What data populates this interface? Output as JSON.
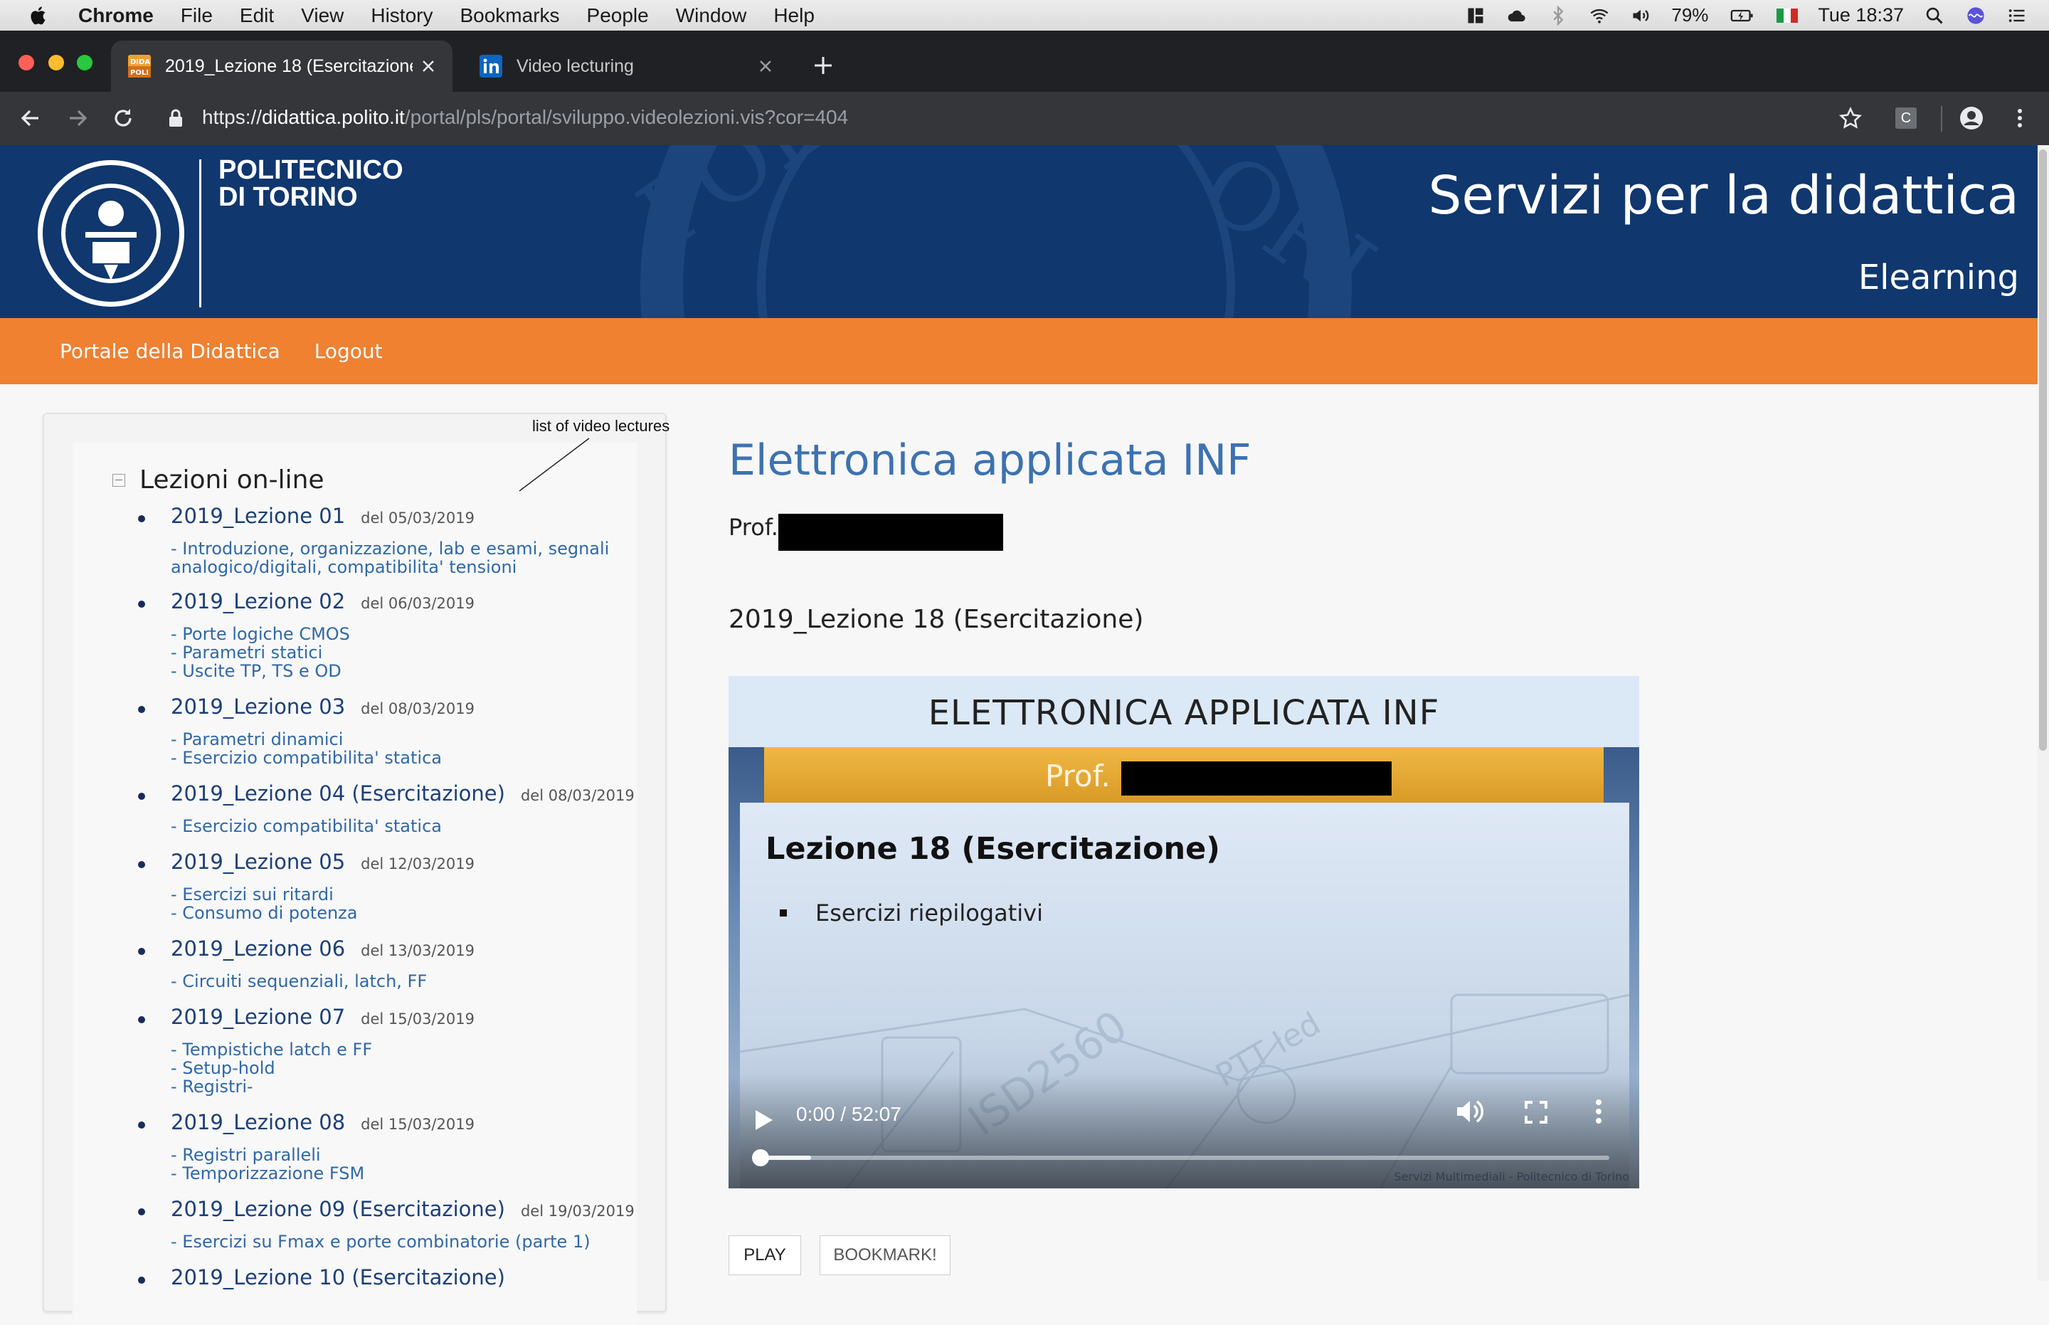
{
  "menubar": {
    "app": "Chrome",
    "items": [
      "File",
      "Edit",
      "View",
      "History",
      "Bookmarks",
      "People",
      "Window",
      "Help"
    ],
    "battery": "79%",
    "clock": "Tue 18:37"
  },
  "browser": {
    "tabs": [
      {
        "title": "2019_Lezione 18 (Esercitazione)",
        "favicon": "didattica-polito-icon",
        "active": true
      },
      {
        "title": "Video lecturing",
        "favicon": "linkedin-icon",
        "active": false
      }
    ],
    "url_protocol": "https://",
    "url_host": "didattica.polito.it",
    "url_path": "/portal/pls/portal/sviluppo.videolezioni.vis?cor=404",
    "extension_label": "C"
  },
  "header": {
    "logo_line1": "POLITECNICO",
    "logo_line2": "DI TORINO",
    "service_title": "Servizi per la didattica",
    "service_subtitle": "Elearning",
    "color": "#10376e"
  },
  "nav": {
    "links": [
      "Portale della Didattica",
      "Logout"
    ],
    "color": "#ef8131"
  },
  "sidebar": {
    "annotation": "list of video lectures",
    "tree_title": "Lezioni on-line",
    "lessons": [
      {
        "name": "2019_Lezione 01",
        "date": "del 05/03/2019",
        "topics": [
          "- Introduzione, organizzazione, lab e esami, segnali",
          "analogico/digitali, compatibilita' tensioni"
        ]
      },
      {
        "name": "2019_Lezione 02",
        "date": "del 06/03/2019",
        "topics": [
          "- Porte logiche CMOS",
          "- Parametri statici",
          "- Uscite TP, TS e OD"
        ]
      },
      {
        "name": "2019_Lezione 03",
        "date": "del 08/03/2019",
        "topics": [
          "- Parametri dinamici",
          "- Esercizio compatibilita' statica"
        ]
      },
      {
        "name": "2019_Lezione 04 (Esercitazione)",
        "date": "del 08/03/2019",
        "topics": [
          "- Esercizio compatibilita' statica"
        ]
      },
      {
        "name": "2019_Lezione 05",
        "date": "del 12/03/2019",
        "topics": [
          "- Esercizi sui ritardi",
          "- Consumo di potenza"
        ]
      },
      {
        "name": "2019_Lezione 06",
        "date": "del 13/03/2019",
        "topics": [
          "- Circuiti sequenziali, latch, FF"
        ]
      },
      {
        "name": "2019_Lezione 07",
        "date": "del 15/03/2019",
        "topics": [
          "- Tempistiche latch e FF",
          "- Setup-hold",
          "- Registri-"
        ]
      },
      {
        "name": "2019_Lezione 08",
        "date": "del 15/03/2019",
        "topics": [
          "- Registri paralleli",
          "- Temporizzazione FSM"
        ]
      },
      {
        "name": "2019_Lezione 09 (Esercitazione)",
        "date": "del 19/03/2019",
        "topics": [
          "- Esercizi su Fmax e porte combinatorie (parte 1)"
        ]
      },
      {
        "name": "2019_Lezione 10 (Esercitazione)",
        "date": "",
        "topics": []
      }
    ]
  },
  "main": {
    "course_title": "Elettronica applicata INF",
    "prof_label": "Prof.",
    "lesson_title": "2019_Lezione 18 (Esercitazione)",
    "video": {
      "slide_header": "ELETTRONICA APPLICATA INF",
      "slide_prof": "Prof.",
      "slide_heading": "Lezione 18 (Esercitazione)",
      "slide_bullet": "Esercizi riepilogativi",
      "time": "0:00 / 52:07",
      "progress": 0.0,
      "credit": "Servizi Multimediali - Politecnico di Torino"
    },
    "buttons": {
      "play": "PLAY",
      "bookmark": "BOOKMARK!"
    }
  }
}
